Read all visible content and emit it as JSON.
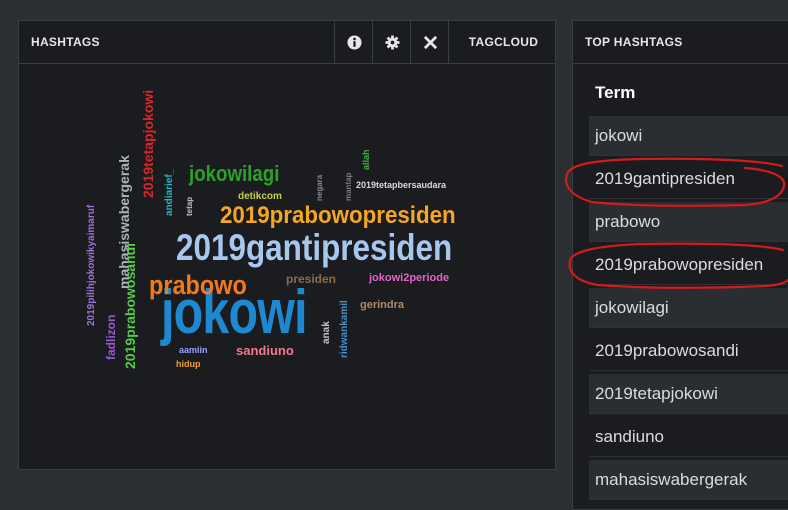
{
  "hashtags_panel": {
    "title": "HASHTAGS",
    "info_icon": "info-circle-icon",
    "settings_icon": "gear-icon",
    "close_icon": "close-icon",
    "tagcloud_label": "TAGCLOUD"
  },
  "cloud_words": [
    {
      "text": "jokowi",
      "color": "#1e88d0"
    },
    {
      "text": "2019gantipresiden",
      "color": "#a9c7ee"
    },
    {
      "text": "2019prabowopresiden",
      "color": "#f5a623"
    },
    {
      "text": "prabowo",
      "color": "#f27a1a"
    },
    {
      "text": "jokowilagi",
      "color": "#2aa22a"
    },
    {
      "text": "2019tetapjokowi",
      "color": "#d62828"
    },
    {
      "text": "mahasiswabergerak",
      "color": "#aeb3bb"
    },
    {
      "text": "2019prabowosandi",
      "color": "#57c84a"
    },
    {
      "text": "2019pilihjokowikyaimaruf",
      "color": "#a06fd8"
    },
    {
      "text": "fadlizon",
      "color": "#9b59d0"
    },
    {
      "text": "sandiuno",
      "color": "#ef7b92"
    },
    {
      "text": "presiden",
      "color": "#8c6b4f"
    },
    {
      "text": "jokowi2periode",
      "color": "#e066c6"
    },
    {
      "text": "gerindra",
      "color": "#b08a6a"
    },
    {
      "text": "detikcom",
      "color": "#c9cf47"
    },
    {
      "text": "2019tetapbersaudara",
      "color": "#d9d9d9"
    },
    {
      "text": "aamiin",
      "color": "#9aa0ff"
    },
    {
      "text": "hidup",
      "color": "#f59f2a"
    },
    {
      "text": "anak",
      "color": "#c8c8c8"
    },
    {
      "text": "ridwankamil",
      "color": "#4a90c8"
    },
    {
      "text": "andiarief_",
      "color": "#20b8c8"
    },
    {
      "text": "tetap",
      "color": "#c0c0c0"
    },
    {
      "text": "negara",
      "color": "#888888"
    },
    {
      "text": "mantap",
      "color": "#7a7a7a"
    },
    {
      "text": "allah",
      "color": "#46b04a"
    }
  ],
  "top_panel": {
    "title": "TOP HASHTAGS",
    "column_header": "Term",
    "rows": [
      "jokowi",
      "2019gantipresiden",
      "prabowo",
      "2019prabowopresiden",
      "jokowilagi",
      "2019prabowosandi",
      "2019tetapjokowi",
      "sandiuno",
      "mahasiswabergerak"
    ]
  },
  "annotation_color": "#d21b1b"
}
